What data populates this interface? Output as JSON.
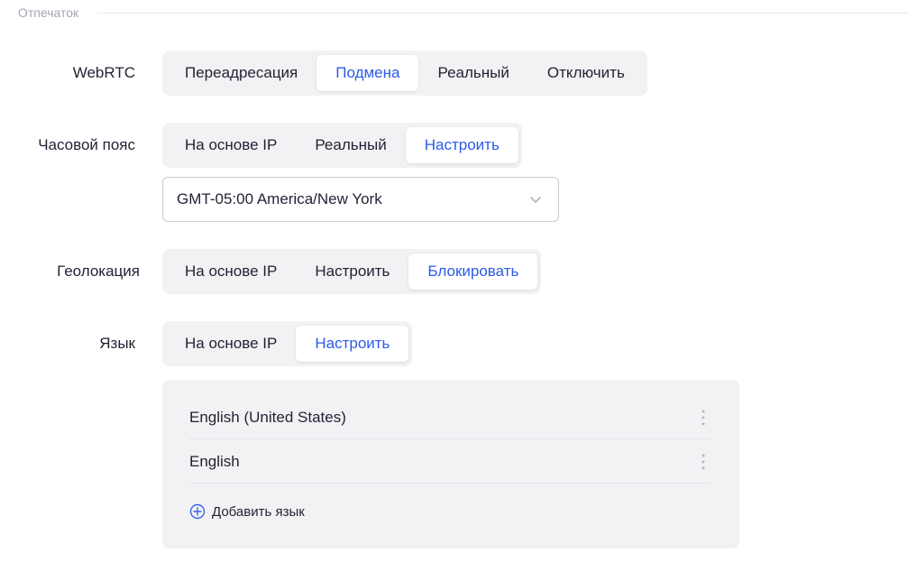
{
  "section": {
    "title": "Отпечаток"
  },
  "webrtc": {
    "label": "WebRTC",
    "options": [
      "Переадресация",
      "Подмена",
      "Реальный",
      "Отключить"
    ],
    "selected": "Подмена"
  },
  "timezone": {
    "label": "Часовой пояс",
    "options": [
      "На основе IP",
      "Реальный",
      "Настроить"
    ],
    "selected": "Настроить",
    "select_value": "GMT-05:00 America/New York"
  },
  "geolocation": {
    "label": "Геолокация",
    "options": [
      "На основе IP",
      "Настроить",
      "Блокировать"
    ],
    "selected": "Блокировать"
  },
  "language": {
    "label": "Язык",
    "options": [
      "На основе IP",
      "Настроить"
    ],
    "selected": "Настроить",
    "list": [
      "English (United States)",
      "English"
    ],
    "add_label": "Добавить язык"
  },
  "colors": {
    "accent": "#2c5be8",
    "segment_bg": "#f2f2f4",
    "text": "#1f2233"
  }
}
